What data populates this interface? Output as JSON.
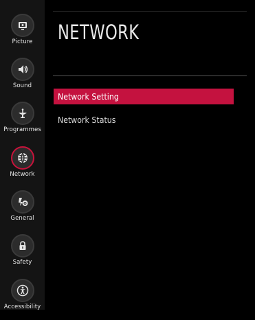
{
  "sidebar": {
    "items": [
      {
        "label": "Picture",
        "icon": "picture-icon"
      },
      {
        "label": "Sound",
        "icon": "speaker-icon"
      },
      {
        "label": "Programmes",
        "icon": "satellite-dish-icon"
      },
      {
        "label": "Network",
        "icon": "globe-icon"
      },
      {
        "label": "General",
        "icon": "gears-icon"
      },
      {
        "label": "Safety",
        "icon": "padlock-icon"
      },
      {
        "label": "Accessibility",
        "icon": "accessibility-icon"
      }
    ],
    "active": "Network"
  },
  "main": {
    "title": "NETWORK",
    "menu": [
      {
        "label": "Network Setting",
        "selected": true
      },
      {
        "label": "Network Status",
        "selected": false
      }
    ]
  },
  "colors": {
    "accent": "#c4123f",
    "sidebar_bg": "#141414",
    "background": "#000000"
  }
}
